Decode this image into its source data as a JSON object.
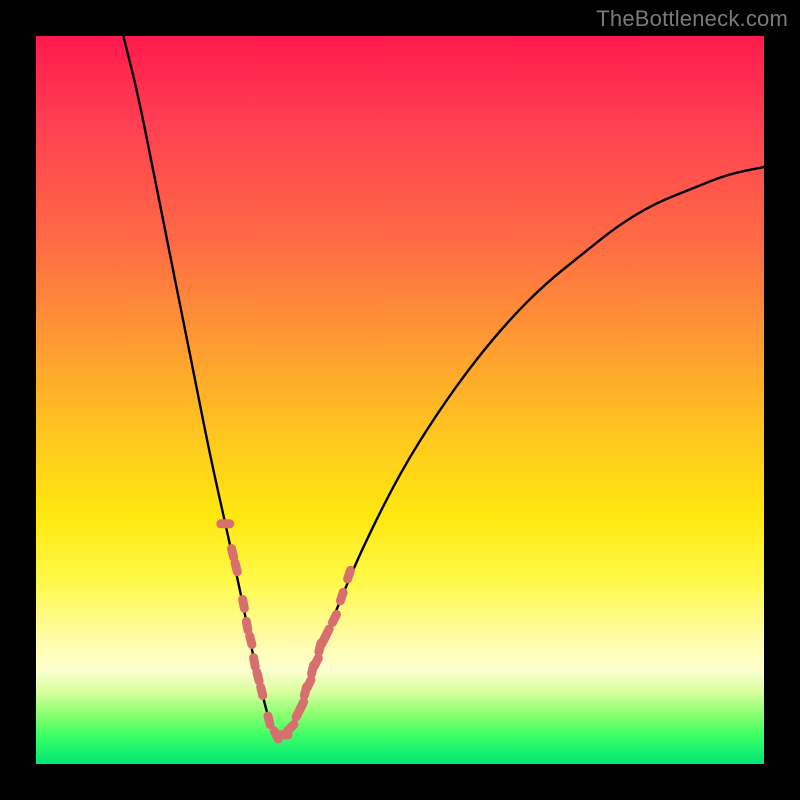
{
  "watermark": "TheBottleneck.com",
  "colors": {
    "frame": "#000000",
    "curve": "#000000",
    "marker": "#d86f6f",
    "gradient_stops": [
      "#ff1a4d",
      "#ff3f52",
      "#ff6a45",
      "#ff9a33",
      "#ffc71f",
      "#ffe80f",
      "#fff94a",
      "#fffc9e",
      "#feffd0",
      "#d9ffa0",
      "#8fff70",
      "#3eff66",
      "#00e676"
    ]
  },
  "chart_data": {
    "type": "line",
    "title": "",
    "xlabel": "",
    "ylabel": "",
    "xlim": [
      0,
      100
    ],
    "ylim": [
      0,
      100
    ],
    "minimum_x": 33,
    "curve": {
      "name": "bottleneck-curve",
      "x": [
        12,
        14,
        16,
        18,
        20,
        22,
        24,
        26,
        28,
        29,
        30,
        31,
        32,
        33,
        34,
        35,
        36,
        37,
        38,
        40,
        42,
        45,
        50,
        55,
        60,
        65,
        70,
        75,
        80,
        85,
        90,
        95,
        100
      ],
      "y": [
        100,
        92,
        82,
        72,
        62,
        52,
        42,
        33,
        24,
        19,
        14,
        10,
        6,
        4,
        4,
        5,
        7,
        10,
        13,
        18,
        23,
        30,
        40,
        48,
        55,
        61,
        66,
        70,
        74,
        77,
        79,
        81,
        82
      ]
    },
    "markers": {
      "name": "highlighted-points",
      "x": [
        26,
        27,
        27.5,
        28.5,
        29,
        29.5,
        30,
        30.5,
        31,
        32,
        33,
        34,
        35,
        36,
        36.5,
        37,
        37.5,
        38,
        38.5,
        39,
        39.5,
        40,
        41,
        42,
        43
      ],
      "y": [
        33,
        29,
        27,
        22,
        19,
        17,
        14,
        12,
        10,
        6,
        4,
        4,
        5,
        7,
        8,
        10,
        11,
        13,
        14,
        16,
        17,
        18,
        20,
        23,
        26
      ]
    }
  }
}
